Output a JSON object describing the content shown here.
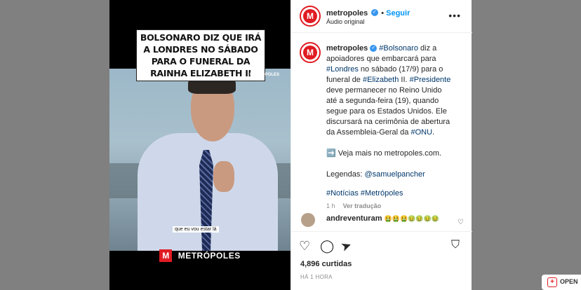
{
  "media": {
    "headline": "BOLSONARO DIZ QUE IRÁ A LONDRES NO SÁBADO PARA O FUNERAL DA RAINHA ELIZABETH II",
    "watermark": "METRÓPOLES",
    "caption": "que eu vou estar lá",
    "logo_text": "METRÓPOLES",
    "logo_letter": "M"
  },
  "header": {
    "username": "metropoles",
    "follow_label": "Seguir",
    "audio": "Áudio original",
    "more_icon": "more-horizontal-icon"
  },
  "post": {
    "username": "metropoles",
    "lines": [
      {
        "parts": [
          {
            "t": "#Bolsonaro",
            "tag": true
          },
          {
            "t": " diz a",
            "tag": false
          }
        ]
      },
      {
        "parts": [
          {
            "t": "apoiadores que embarcará para",
            "tag": false
          }
        ]
      },
      {
        "parts": [
          {
            "t": "#Londres",
            "tag": true
          },
          {
            "t": " no sábado (17/9) para o",
            "tag": false
          }
        ]
      },
      {
        "parts": [
          {
            "t": "funeral de ",
            "tag": false
          },
          {
            "t": "#Elizabeth",
            "tag": true
          },
          {
            "t": " II. ",
            "tag": false
          },
          {
            "t": "#Presidente",
            "tag": true
          }
        ]
      },
      {
        "parts": [
          {
            "t": "deve permanecer no Reino Unido",
            "tag": false
          }
        ]
      },
      {
        "parts": [
          {
            "t": "até a segunda-feira (19), quando",
            "tag": false
          }
        ]
      },
      {
        "parts": [
          {
            "t": "segue para os Estados Unidos. Ele",
            "tag": false
          }
        ]
      },
      {
        "parts": [
          {
            "t": "discursará na cerimônia de abertura",
            "tag": false
          }
        ]
      },
      {
        "parts": [
          {
            "t": "da Assembleia-Geral da ",
            "tag": false
          },
          {
            "t": "#ONU",
            "tag": true
          },
          {
            "t": ".",
            "tag": false
          }
        ]
      }
    ],
    "more_link": "➡️ Veja mais no metropoles.com.",
    "legend_label": "Legendas: ",
    "legend_user": "@samuelpancher",
    "hashtags": "#Notícias #Metrópoles",
    "time_ago": "1 h",
    "translate": "Ver tradução"
  },
  "comment": {
    "username": "andreventuram",
    "text": "🤮🤮🤮🤢🤢🤢🤢"
  },
  "actions": {
    "likes": "4,896 curtidas",
    "time": "HÁ 1 HORA"
  },
  "open_pill": {
    "label": "OPEN"
  },
  "colors": {
    "accent": "#e11b22",
    "link": "#0095f6",
    "hashtag": "#00376b"
  }
}
